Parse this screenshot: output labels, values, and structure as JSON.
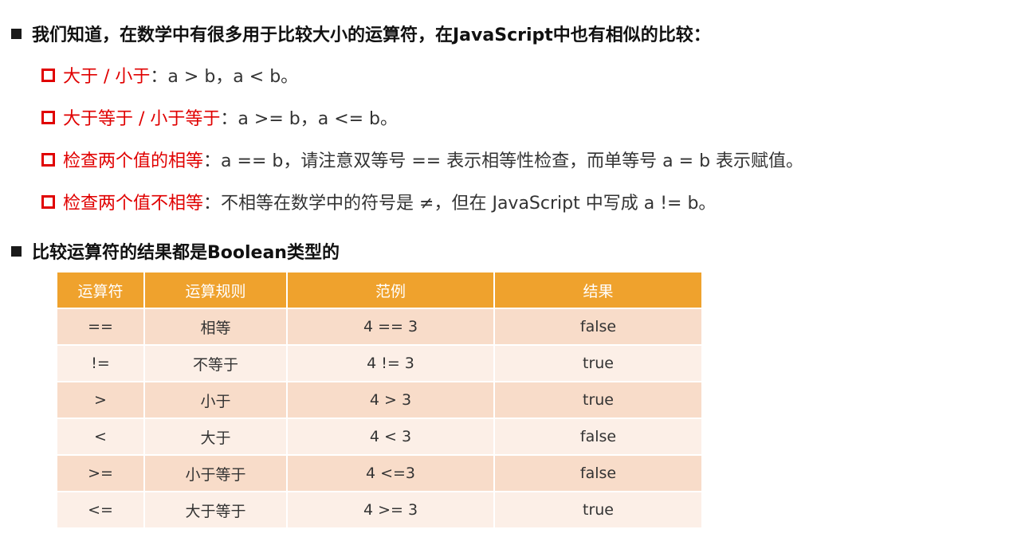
{
  "heading1": "我们知道，在数学中有很多用于比较大小的运算符，在JavaScript中也有相似的比较：",
  "items": [
    {
      "term": "大于 / 小于",
      "sep": "：",
      "desc": "a > b，a < b。"
    },
    {
      "term": "大于等于 / 小于等于",
      "sep": "：",
      "desc": "a >= b，a <= b。"
    },
    {
      "term": "检查两个值的相等",
      "sep": "：",
      "desc": "a == b，请注意双等号 == 表示相等性检查，而单等号 a = b 表示赋值。"
    },
    {
      "term": "检查两个值不相等",
      "sep": "：",
      "desc": "不相等在数学中的符号是 ≠，但在 JavaScript 中写成 a != b。"
    }
  ],
  "heading2": "比较运算符的结果都是Boolean类型的",
  "table": {
    "headers": [
      "运算符",
      "运算规则",
      "范例",
      "结果"
    ],
    "rows": [
      [
        "==",
        "相等",
        "4 == 3",
        "false"
      ],
      [
        "!=",
        "不等于",
        "4 != 3",
        "true"
      ],
      [
        ">",
        "小于",
        "4 > 3",
        "true"
      ],
      [
        "<",
        "大于",
        "4 < 3",
        "false"
      ],
      [
        ">=",
        "小于等于",
        "4 <=3",
        "false"
      ],
      [
        "<=",
        "大于等于",
        "4 >= 3",
        "true"
      ]
    ]
  },
  "colors": {
    "accent_red": "#e00000",
    "table_header": "#efa22d",
    "row_dark": "#f8dcc9",
    "row_light": "#fcefe7"
  }
}
